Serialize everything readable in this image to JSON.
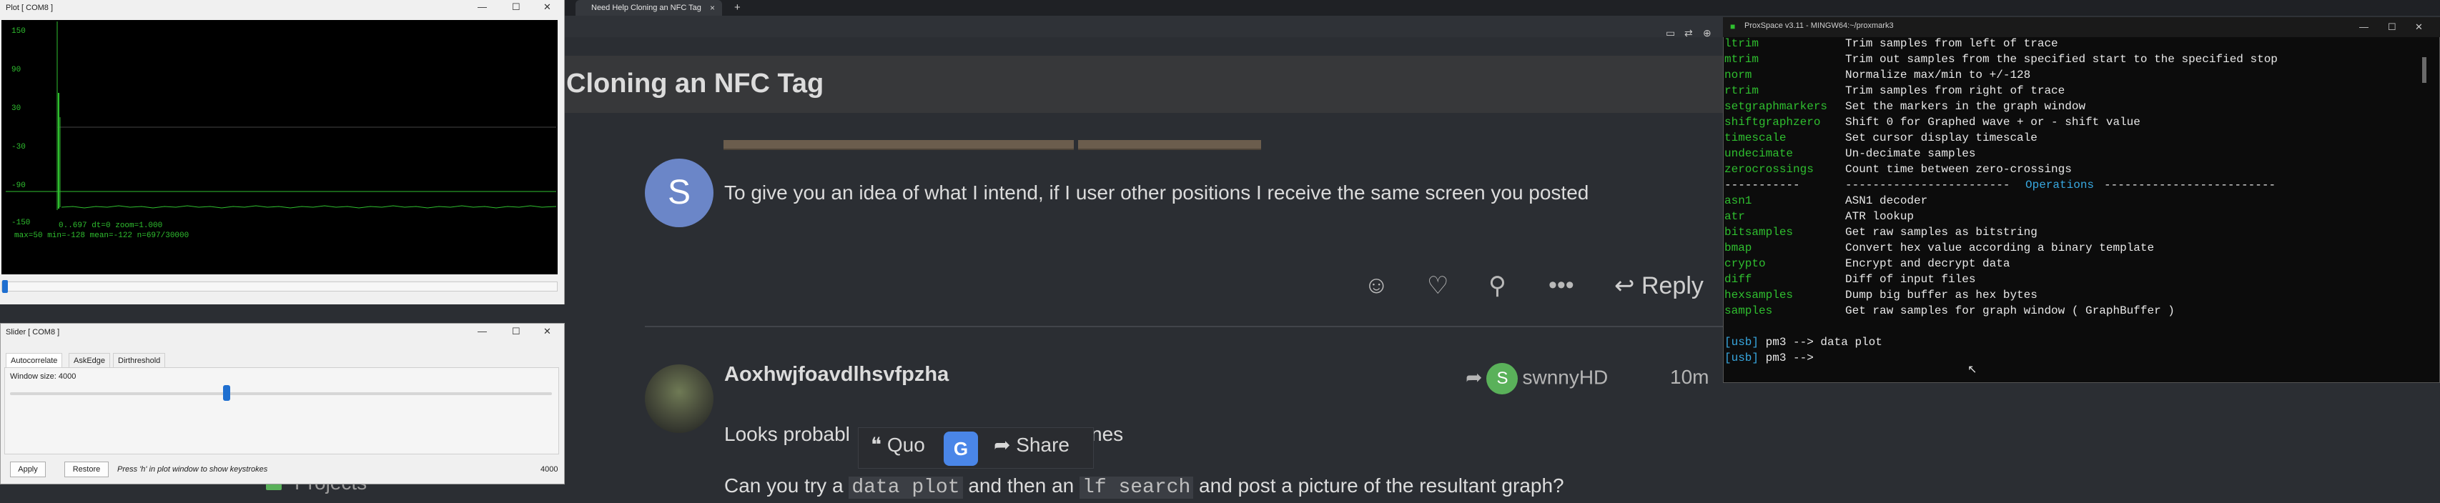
{
  "browser": {
    "tab_title": "Need Help Cloning an NFC Tag",
    "tab_close": "×",
    "new_tab": "+",
    "toolbar_icons": [
      "screen-icon",
      "translate-icon",
      "zoom-icon"
    ],
    "topic_title": "Cloning an NFC Tag",
    "post1": {
      "avatar_letter": "S",
      "text": "To give you an idea of what I intend, if I user other positions I receive the same screen you posted",
      "reply_label": "Reply"
    },
    "post2": {
      "username": "Aoxhwjfoavdlhsvfpzha",
      "reply_to_letter": "S",
      "reply_to_user": "swnnyHD",
      "time": "10m",
      "line1": "Looks probabl",
      "line1_tail": "nes",
      "line2_a": "Can you try a",
      "line2_code1": "data plot",
      "line2_b": "and then an",
      "line2_code2": "lf search",
      "line2_c": "and post a picture of the resultant graph?"
    },
    "popup": {
      "quote": "Quo",
      "share": "Share",
      "translate_letter": "G"
    },
    "sidebar_link": "Projects"
  },
  "plot_window": {
    "title": "Plot [ COM8 ]",
    "y_ticks": [
      "150",
      "90",
      "30",
      "-30",
      "-90",
      "-150"
    ],
    "status_line1": "0..697  dt=0  zoom=1.000",
    "status_line2": "max=50  min=-128  mean=-122  n=697/30000"
  },
  "slider_window": {
    "title": "Slider [ COM8 ]",
    "tabs": [
      "Autocorrelate",
      "AskEdge",
      "Dirthreshold"
    ],
    "active_tab": "Autocorrelate",
    "window_size_label": "Window size",
    "window_size_value": "4000",
    "slider_level": 0.4,
    "apply_label": "Apply",
    "restore_label": "Restore",
    "hint": "Press 'h' in plot window to show keystrokes",
    "footer_value": "4000"
  },
  "terminal": {
    "title": "ProxSpace v3.11 - MINGW64:~/proxmark3",
    "commands_1": [
      {
        "cmd": "ltrim",
        "desc": "Trim samples from left of trace"
      },
      {
        "cmd": "mtrim",
        "desc": "Trim out samples from the specified start to the specified stop"
      },
      {
        "cmd": "norm",
        "desc": "Normalize max/min to +/-128"
      },
      {
        "cmd": "rtrim",
        "desc": "Trim samples from right of trace"
      },
      {
        "cmd": "setgraphmarkers",
        "desc": "Set the markers in the graph window"
      },
      {
        "cmd": "shiftgraphzero",
        "desc": "Shift 0 for Graphed wave + or - shift value"
      },
      {
        "cmd": "timescale",
        "desc": "Set cursor display timescale"
      },
      {
        "cmd": "undecimate",
        "desc": "Un-decimate samples"
      },
      {
        "cmd": "zerocrossings",
        "desc": "Count time between zero-crossings"
      }
    ],
    "section_left": "-----------",
    "section_right_a": "------------------------",
    "section_name": "Operations",
    "section_right_b": "-------------------------",
    "commands_2": [
      {
        "cmd": "asn1",
        "desc": "ASN1 decoder"
      },
      {
        "cmd": "atr",
        "desc": "ATR lookup"
      },
      {
        "cmd": "bitsamples",
        "desc": "Get raw samples as bitstring"
      },
      {
        "cmd": "bmap",
        "desc": "Convert hex value according a binary template"
      },
      {
        "cmd": "crypto",
        "desc": "Encrypt and decrypt data"
      },
      {
        "cmd": "diff",
        "desc": "Diff of input files"
      },
      {
        "cmd": "hexsamples",
        "desc": "Dump big buffer as hex bytes"
      },
      {
        "cmd": "samples",
        "desc": "Get raw samples for graph window ( GraphBuffer )"
      }
    ],
    "prompt1_usb": "[usb]",
    "prompt1_rest": " pm3 --> data plot",
    "prompt2_usb": "[usb]",
    "prompt2_rest": " pm3 -->"
  }
}
